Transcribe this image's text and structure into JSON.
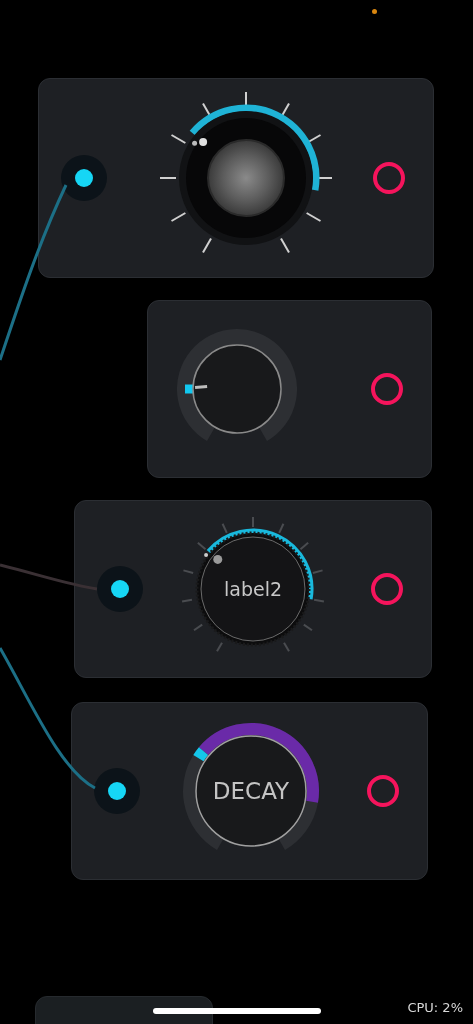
{
  "modules": [
    {
      "kind": "chrome",
      "input": true
    },
    {
      "kind": "plain",
      "input": false
    },
    {
      "kind": "knurled",
      "label": "label2",
      "input": true
    },
    {
      "kind": "labeled",
      "label": "DECAY",
      "input": true
    }
  ],
  "status": {
    "cpu": "CPU: 2%"
  }
}
